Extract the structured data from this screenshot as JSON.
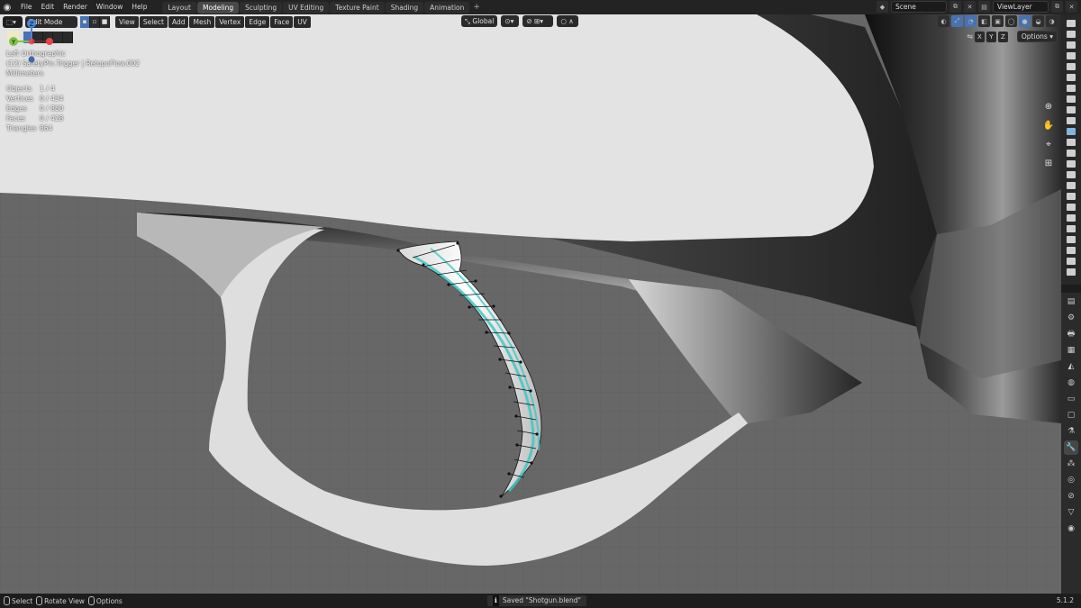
{
  "topbar": {
    "menu": [
      "File",
      "Edit",
      "Render",
      "Window",
      "Help"
    ],
    "tabs": [
      "Layout",
      "Modeling",
      "Sculpting",
      "UV Editing",
      "Texture Paint",
      "Shading",
      "Animation"
    ],
    "active_tab": "Modeling",
    "add_tab": "+",
    "scene": "Scene",
    "view_layer": "ViewLayer"
  },
  "viewport_header": {
    "mode": "Edit Mode",
    "menus": [
      "View",
      "Select",
      "Add",
      "Mesh",
      "Vertex",
      "Edge",
      "Face",
      "UV"
    ],
    "orientation": "Global",
    "options": "Options",
    "axes": [
      "X",
      "Y",
      "Z"
    ]
  },
  "overlay": {
    "view": "Left Orthographic",
    "object": "(12) SafetyPin.Trigger | RetopoFlow.002",
    "units": "Millimeters",
    "stats": [
      {
        "label": "Objects",
        "value": "1 / 4"
      },
      {
        "label": "Vertices",
        "value": "0 / 434"
      },
      {
        "label": "Edges",
        "value": "0 / 860"
      },
      {
        "label": "Faces",
        "value": "0 / 428"
      },
      {
        "label": "Triangles",
        "value": "864"
      }
    ]
  },
  "gizmo": {
    "x": "X",
    "y": "Y",
    "z": "Z"
  },
  "statusbar": {
    "select": "Select",
    "rotate": "Rotate View",
    "options": "Options",
    "message": "Saved \"Shotgun.blend\"",
    "version": "5.1.2"
  },
  "colors": {
    "viewport_bg": "#676767",
    "active_blue": "#4772b3",
    "mesh_cyan": "#3fc6c6",
    "axis_x": "#e8434a",
    "axis_y": "#7fc34a",
    "axis_z": "#4c86d8"
  }
}
